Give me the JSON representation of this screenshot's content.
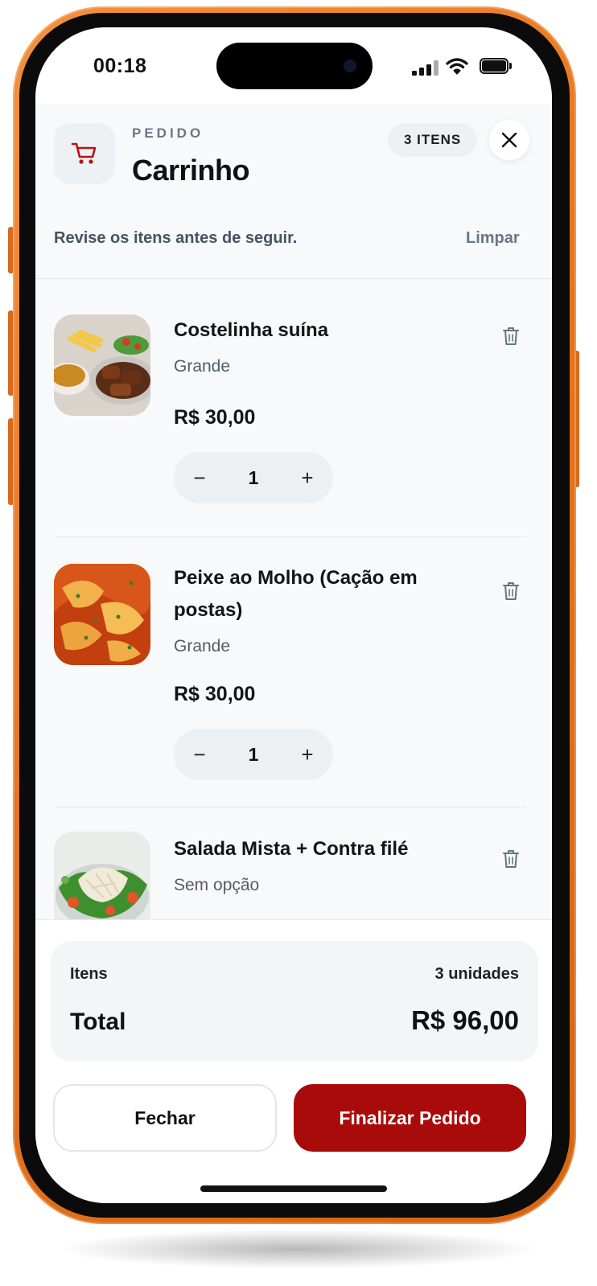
{
  "status_bar": {
    "time": "00:18"
  },
  "header": {
    "eyebrow": "PEDIDO",
    "title": "Carrinho",
    "count_badge": "3 ITENS",
    "subtitle": "Revise os itens antes de seguir.",
    "clear_label": "Limpar"
  },
  "items": [
    {
      "name": "Costelinha suína",
      "option": "Grande",
      "price": "R$ 30,00",
      "quantity": "1",
      "image": "pork-ribs-plate"
    },
    {
      "name": "Peixe ao Molho (Cação em postas)",
      "option": "Grande",
      "price": "R$ 30,00",
      "quantity": "1",
      "image": "fish-in-sauce"
    },
    {
      "name": "Salada Mista + Contra filé",
      "option": "Sem opção",
      "price": "",
      "quantity": "",
      "image": "mixed-salad"
    }
  ],
  "summary": {
    "items_label": "Itens",
    "items_units": "3 unidades",
    "total_label": "Total",
    "total_value": "R$ 96,00"
  },
  "actions": {
    "close_label": "Fechar",
    "checkout_label": "Finalizar Pedido"
  },
  "colors": {
    "accent": "#a90b0b",
    "frame": "#e7761e",
    "background": "#f7f9fb"
  },
  "icons": [
    "cart-icon",
    "close-icon",
    "trash-icon",
    "minus-icon",
    "plus-icon"
  ]
}
